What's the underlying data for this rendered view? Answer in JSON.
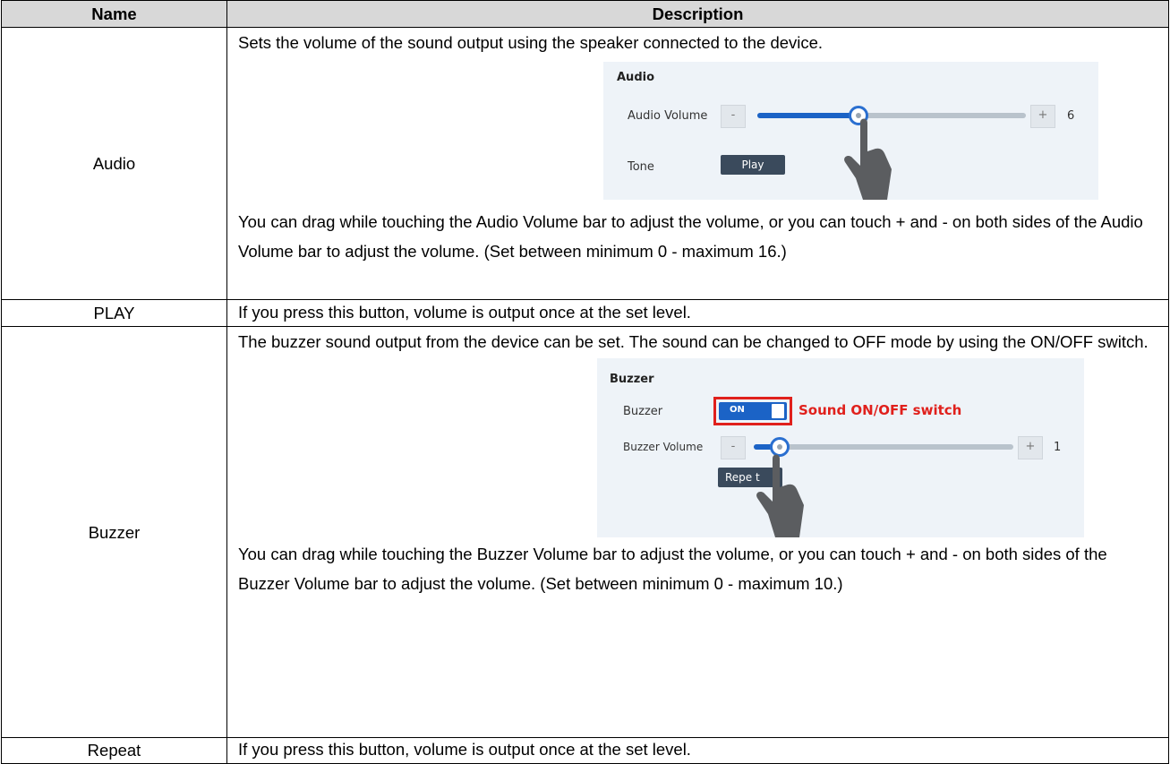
{
  "table": {
    "headers": {
      "name": "Name",
      "description": "Description"
    },
    "rows": {
      "audio": {
        "name": "Audio",
        "intro": "Sets the volume of the sound output using the speaker connected to the device.",
        "figure": {
          "section_title": "Audio",
          "volume_label": "Audio Volume",
          "minus": "-",
          "plus": "+",
          "value": "6",
          "level_fraction": 0.375,
          "tone_label": "Tone",
          "play_button": "Play"
        },
        "note": "You can drag while touching the Audio Volume bar to adjust the volume, or you can touch + and - on both sides of the Audio Volume bar to adjust the volume. (Set between minimum 0 - maximum 16.)"
      },
      "play": {
        "name": "PLAY",
        "description": "If you press this button, volume is output once at the set level."
      },
      "buzzer": {
        "name": "Buzzer",
        "intro": "The buzzer sound output from the device can be set. The sound can be changed to OFF mode by using the ON/OFF switch.",
        "figure": {
          "section_title": "Buzzer",
          "buzzer_label": "Buzzer",
          "switch_state": "ON",
          "annotation": "Sound ON/OFF switch",
          "volume_label": "Buzzer Volume",
          "minus": "-",
          "plus": "+",
          "value": "1",
          "level_fraction": 0.1,
          "repeat_button": "Repe t"
        },
        "note": "You can drag while touching the Buzzer Volume bar to adjust the volume, or you can touch + and - on both sides of the Buzzer Volume bar to adjust the volume. (Set between minimum 0 - maximum 10.)"
      },
      "repeat": {
        "name": "Repeat",
        "description": "If you press this button, volume is output once at the set level."
      }
    }
  },
  "colors": {
    "header_bg": "#d8d8d8",
    "accent_blue": "#1b63c6",
    "highlight_red": "#e0201c",
    "figure_bg": "#eef3f8"
  },
  "icons": [
    "touch-hand-icon",
    "slider-knob-icon"
  ]
}
